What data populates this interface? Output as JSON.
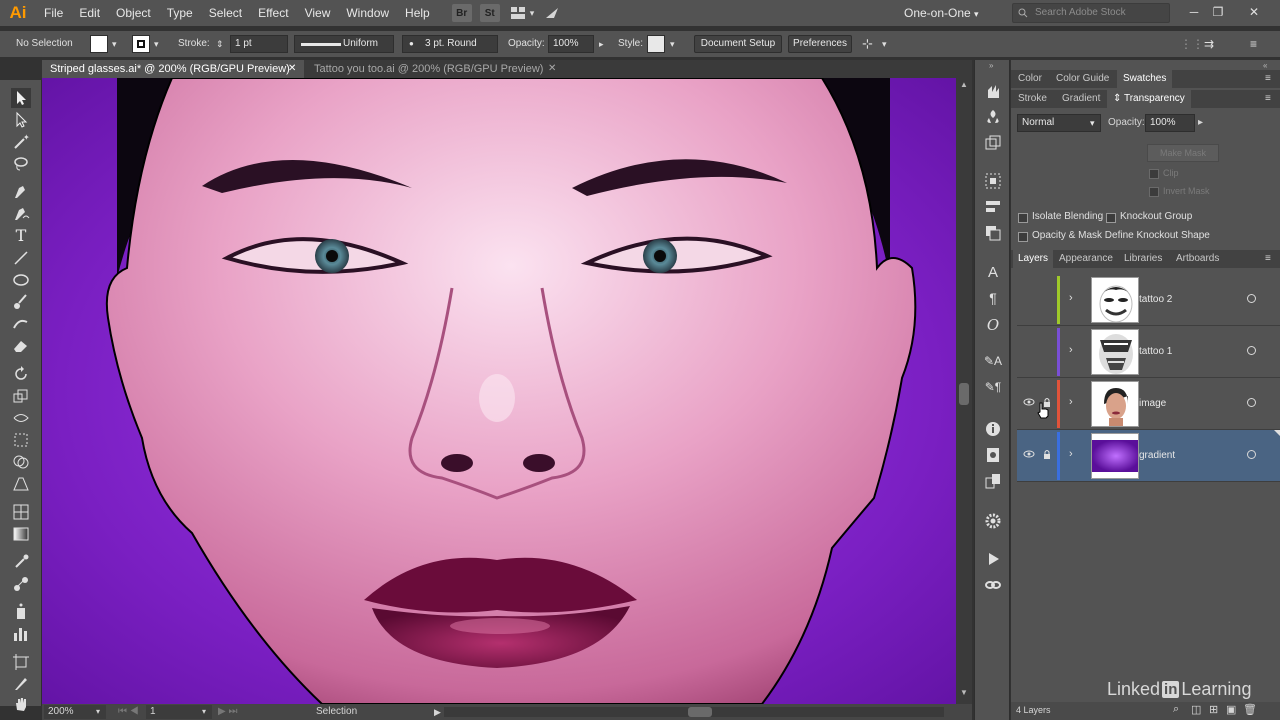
{
  "app": {
    "logo": "Ai",
    "menu": [
      "File",
      "Edit",
      "Object",
      "Type",
      "Select",
      "Effect",
      "View",
      "Window",
      "Help"
    ],
    "menu_icons": [
      "Br",
      "St"
    ],
    "workspace": "One-on-One",
    "stock_search_placeholder": "Search Adobe Stock"
  },
  "control_bar": {
    "selection": "No Selection",
    "stroke_label": "Stroke:",
    "stroke_weight": "1 pt",
    "profile": "Uniform",
    "brush": "3 pt. Round",
    "opacity_label": "Opacity:",
    "opacity": "100%",
    "style_label": "Style:",
    "document_setup": "Document Setup",
    "preferences": "Preferences"
  },
  "tabs": [
    {
      "label": "Striped glasses.ai* @ 200% (RGB/GPU Preview)",
      "active": true
    },
    {
      "label": "Tattoo you too.ai @ 200% (RGB/GPU Preview)",
      "active": false
    }
  ],
  "status": {
    "zoom": "200%",
    "artboard": "1",
    "tool": "Selection"
  },
  "panels": {
    "top_tabs": [
      "Color",
      "Color Guide",
      "Swatches"
    ],
    "second_tabs": [
      "Stroke",
      "Gradient",
      "Transparency"
    ],
    "transparency": {
      "blend_mode": "Normal",
      "opacity_label": "Opacity:",
      "opacity": "100%",
      "make_mask": "Make Mask",
      "clip": "Clip",
      "invert_mask": "Invert Mask",
      "isolate_blending": "Isolate Blending",
      "knockout_group": "Knockout Group",
      "opacity_mask_knockout": "Opacity & Mask Define Knockout Shape"
    },
    "layer_tabs": [
      "Layers",
      "Appearance",
      "Libraries",
      "Artboards"
    ],
    "layers": [
      {
        "name": "tattoo 2",
        "color": "#9fc92a",
        "visible": false,
        "locked": false,
        "selected": false
      },
      {
        "name": "tattoo 1",
        "color": "#7a4fd6",
        "visible": false,
        "locked": false,
        "selected": false
      },
      {
        "name": "image",
        "color": "#e0533a",
        "visible": true,
        "locked": true,
        "selected": false
      },
      {
        "name": "gradient",
        "color": "#3a6fe0",
        "visible": true,
        "locked": true,
        "selected": true
      }
    ],
    "layers_count": "4 Layers"
  },
  "watermark": {
    "brand": "Linked",
    "brand_in": "in",
    "product": "Learning"
  },
  "colors": {
    "canvas_purple": "#7a1fc2",
    "selected_layer": "#4a6483",
    "ai_orange": "#ff9a00"
  }
}
